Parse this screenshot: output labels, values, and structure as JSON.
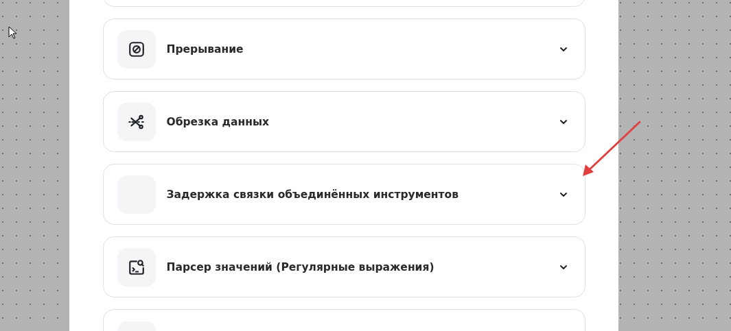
{
  "cards": [
    {
      "kind": "partial"
    },
    {
      "kind": "stop",
      "title": "Прерывание",
      "expanded": false
    },
    {
      "kind": "scissors",
      "title": "Обрезка данных",
      "expanded": false
    },
    {
      "kind": "blank",
      "title": "Задержка связки объединённых инструментов",
      "expanded": false
    },
    {
      "kind": "terminal-search",
      "title": "Парсер значений (Регулярные выражения)",
      "expanded": false
    },
    {
      "kind": "partial-tile"
    }
  ]
}
